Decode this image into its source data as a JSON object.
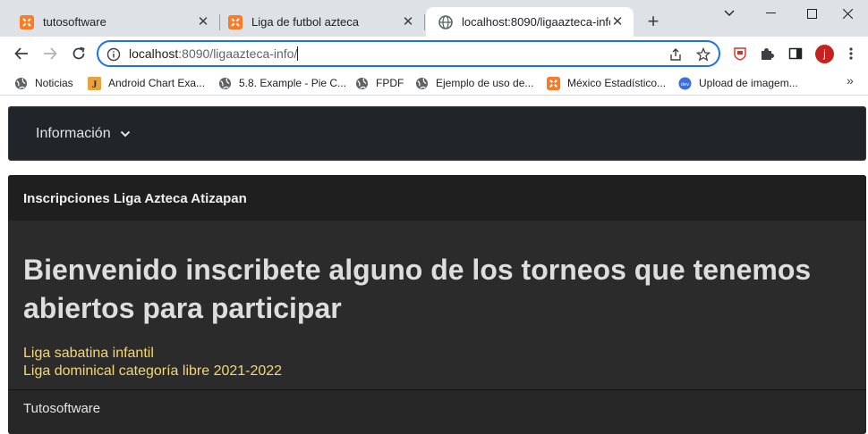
{
  "browser": {
    "tabs": [
      {
        "title": "tutosoftware",
        "icon": "xampp-icon",
        "active": false
      },
      {
        "title": "Liga de futbol azteca",
        "icon": "xampp-icon",
        "active": false
      },
      {
        "title": "localhost:8090/ligaazteca-info/",
        "icon": "globe-icon",
        "active": true
      }
    ],
    "address_bar": {
      "host": "localhost",
      "path": ":8090/ligaazteca-info/"
    },
    "profile_initial": "j",
    "bookmarks": [
      {
        "label": "Noticias",
        "icon": "globe-icon"
      },
      {
        "label": "Android Chart Exa...",
        "icon": "j-logo-icon"
      },
      {
        "label": "5.8. Example - Pie C...",
        "icon": "globe-icon"
      },
      {
        "label": "FPDF",
        "icon": "globe-icon"
      },
      {
        "label": "Ejemplo de uso de...",
        "icon": "globe-icon"
      },
      {
        "label": "México Estadístico...",
        "icon": "xampp-icon"
      },
      {
        "label": "Upload de imagem...",
        "icon": "dev-logo-icon"
      }
    ],
    "colors": {
      "accent": "#1a73e8",
      "tabstrip": "#dee1e6",
      "avatar": "#c5221f",
      "xampp": "#fb7a24"
    }
  },
  "page": {
    "navbar": {
      "dropdown_label": "Información"
    },
    "card": {
      "header": "Inscripciones Liga Azteca Atizapan",
      "headline": "Bienvenido inscribete alguno de los torneos que tenemos abiertos para participar",
      "leagues": [
        "Liga sabatina infantil",
        "Liga dominical categoría libre 2021-2022"
      ],
      "footer": "Tutosoftware"
    },
    "colors": {
      "navbar_bg": "#212529",
      "card_bg": "#2b2b2b",
      "link": "#f5d76e"
    }
  }
}
